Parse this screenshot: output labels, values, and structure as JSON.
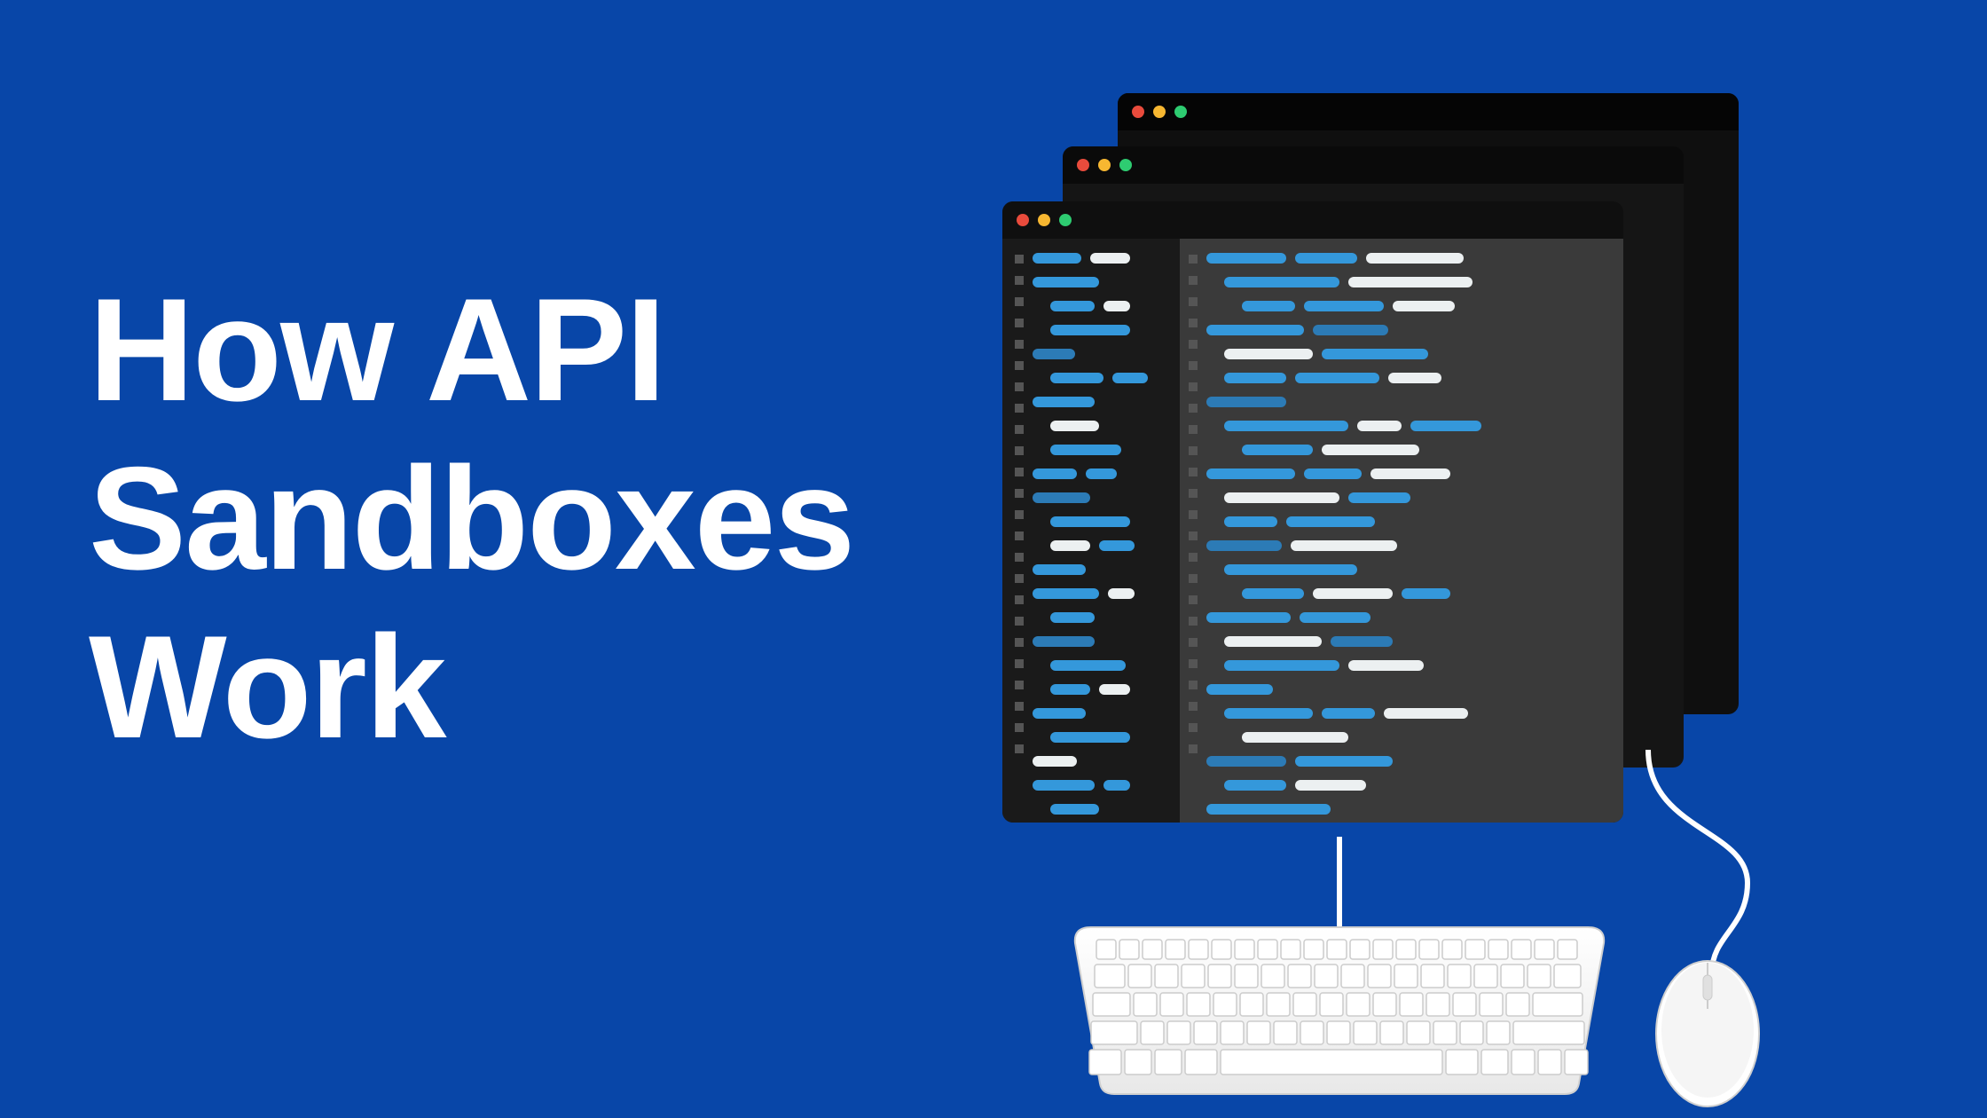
{
  "headline": {
    "line1": "How API",
    "line2": "Sandboxes",
    "line3": "Work"
  },
  "colors": {
    "background": "#0846A8",
    "text": "#ffffff",
    "window_dark": "#1a1a1a",
    "code_blue": "#3498db",
    "code_white": "#ecf0f1",
    "traffic_red": "#e94b3c",
    "traffic_yellow": "#f7b731",
    "traffic_green": "#2ecc71"
  },
  "illustration": {
    "description": "Three stacked dark code-editor windows with traffic-light dots, abstract blue and white code lines, a white keyboard and mouse connected by cables",
    "windows": 3,
    "traffic_lights": [
      "red",
      "yellow",
      "green"
    ]
  }
}
